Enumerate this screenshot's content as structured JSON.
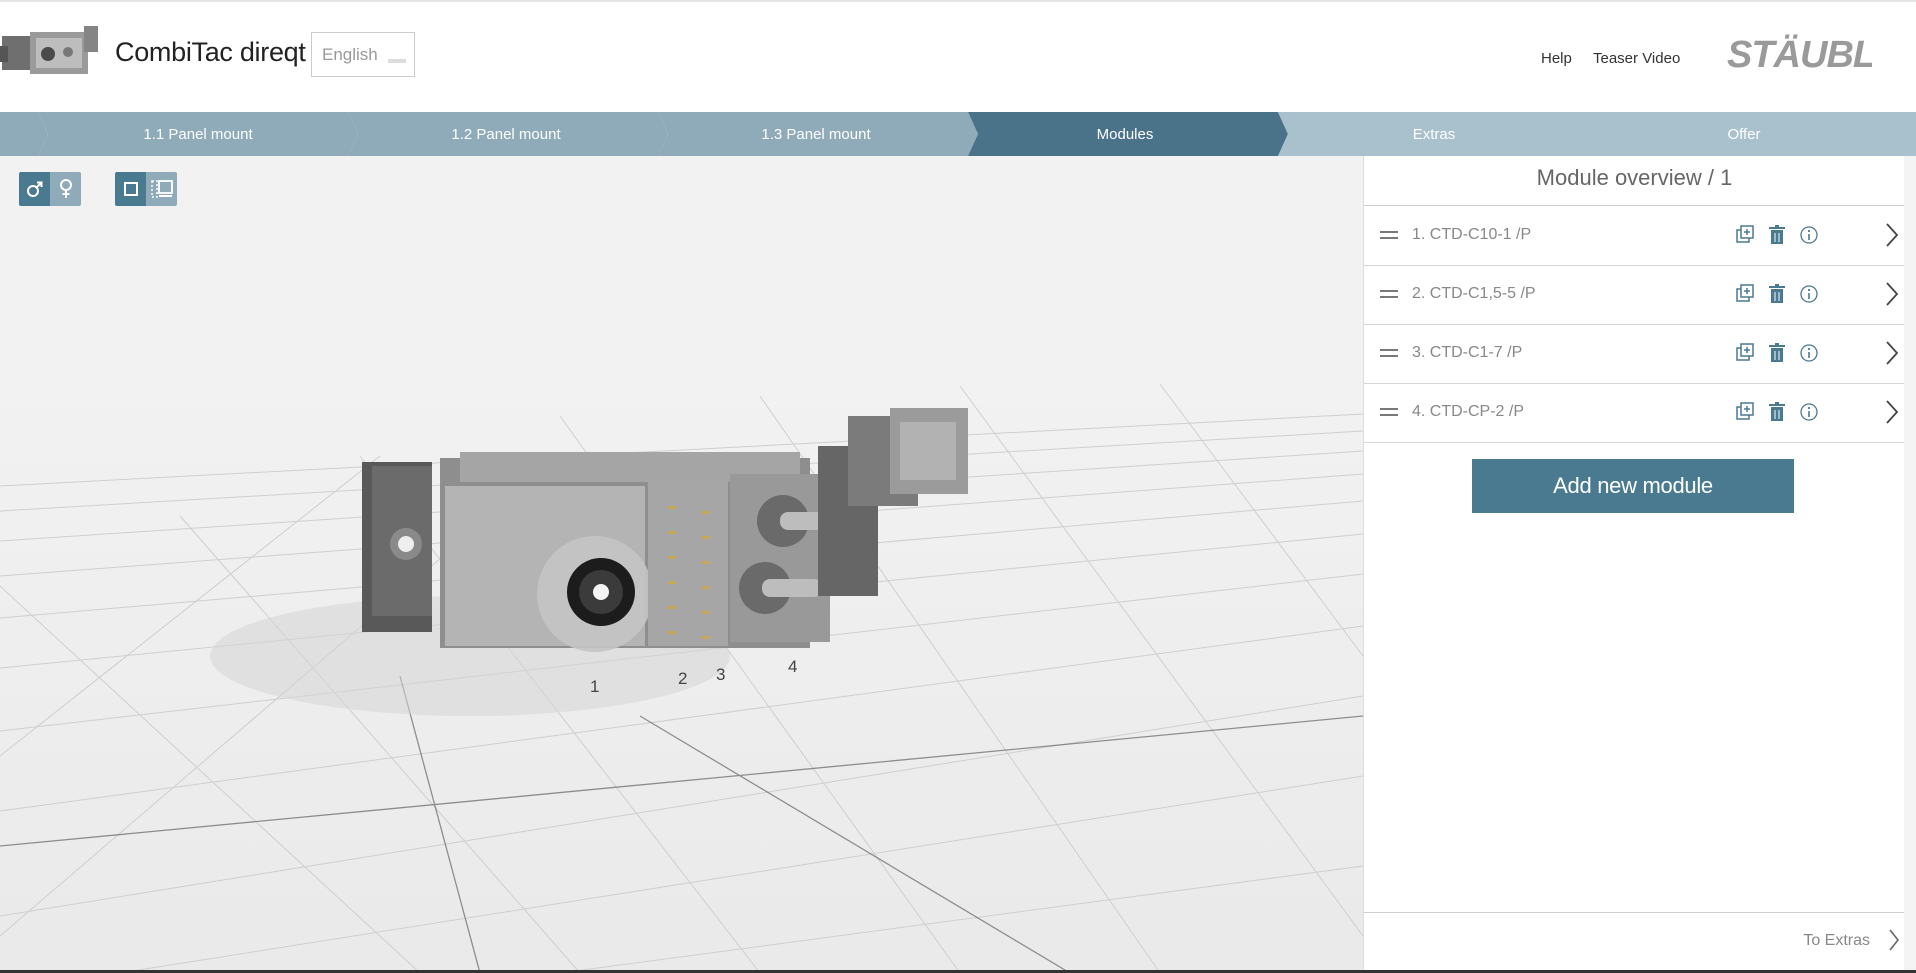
{
  "app": {
    "title": "CombiTac direqt",
    "brand": "STÄUBLI"
  },
  "language": {
    "selected": "English"
  },
  "header_links": [
    {
      "label": "Help"
    },
    {
      "label": "Teaser Video"
    }
  ],
  "steps": [
    {
      "label": "1.1 Panel mount",
      "state": "done"
    },
    {
      "label": "1.2 Panel mount",
      "state": "done"
    },
    {
      "label": "1.3 Panel mount",
      "state": "done"
    },
    {
      "label": "Modules",
      "state": "active"
    },
    {
      "label": "Extras",
      "state": "todo"
    },
    {
      "label": "Offer",
      "state": "todo"
    }
  ],
  "viewer": {
    "toggles": [
      {
        "name": "gender-toggle",
        "options": [
          "male-icon",
          "female-icon"
        ]
      },
      {
        "name": "view-toggle",
        "options": [
          "single-view-icon",
          "multi-view-icon"
        ]
      }
    ],
    "position_labels": [
      "1",
      "2",
      "3",
      "4"
    ]
  },
  "panel": {
    "title": "Module overview / 1",
    "modules": [
      {
        "label": "1. CTD-C10-1 /P"
      },
      {
        "label": "2. CTD-C1,5-5 /P"
      },
      {
        "label": "3. CTD-C1-7 /P"
      },
      {
        "label": "4. CTD-CP-2 /P"
      }
    ],
    "add_button": "Add new module",
    "next_label": "To Extras"
  },
  "colors": {
    "step_done": "#8faab8",
    "step_active": "#4a7289",
    "step_todo": "#a9c1cd",
    "accent": "#4a7a90",
    "viewer_bg": "#f2f2f2"
  }
}
